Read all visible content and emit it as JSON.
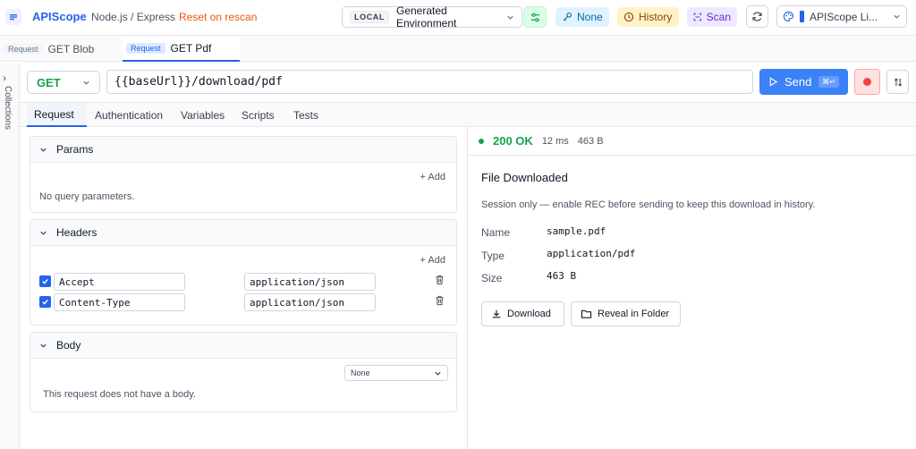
{
  "header": {
    "app_name": "APIScope",
    "project": "Node.js / Express",
    "reset_label": "Reset on rescan",
    "env_badge": "LOCAL",
    "env_name": "Generated Environment",
    "auth_label": "None",
    "history_label": "History",
    "scan_label": "Scan",
    "theme_label": "APIScope Li..."
  },
  "request_tabs": [
    {
      "badge": "Request",
      "label": "GET Blob"
    },
    {
      "badge": "Request",
      "label": "GET Pdf"
    }
  ],
  "sidebar": {
    "collections_label": "Collections"
  },
  "url_bar": {
    "method": "GET",
    "url": "{{baseUrl}}/download/pdf",
    "send_label": "Send",
    "send_shortcut": "⌘↵"
  },
  "section_tabs": [
    "Request",
    "Authentication",
    "Variables",
    "Scripts",
    "Tests"
  ],
  "params": {
    "title": "Params",
    "add_label": "+ Add",
    "empty": "No query parameters."
  },
  "headers": {
    "title": "Headers",
    "add_label": "+ Add",
    "rows": [
      {
        "key": "Accept",
        "value": "application/json"
      },
      {
        "key": "Content-Type",
        "value": "application/json"
      }
    ]
  },
  "body": {
    "title": "Body",
    "type": "None",
    "empty": "This request does not have a body."
  },
  "response": {
    "status": "200 OK",
    "time": "12 ms",
    "size": "463 B",
    "title": "File Downloaded",
    "note": "Session only — enable REC before sending to keep this download in history.",
    "fields": [
      {
        "label": "Name",
        "value": "sample.pdf"
      },
      {
        "label": "Type",
        "value": "application/pdf"
      },
      {
        "label": "Size",
        "value": "463 B"
      }
    ],
    "download_label": "Download",
    "reveal_label": "Reveal in Folder"
  },
  "colors": {
    "accent": "#3b82f6",
    "success": "#16a34a",
    "reset": "#ea580c",
    "record": "#ef4444"
  }
}
